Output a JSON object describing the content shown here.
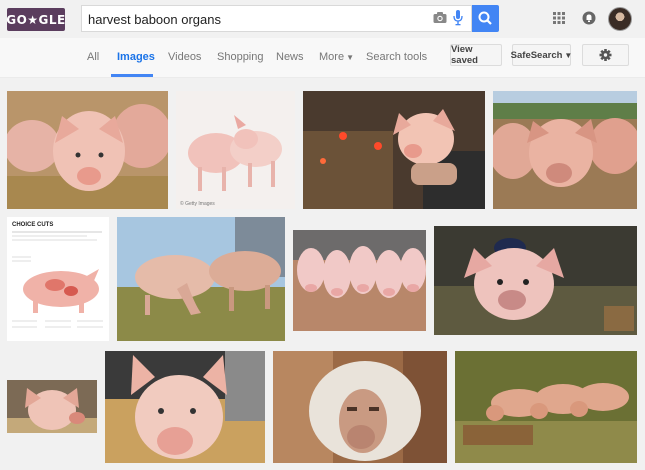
{
  "header": {
    "logo_text": "GO★GLE",
    "search_value": "harvest baboon organs"
  },
  "nav": {
    "tabs": [
      "All",
      "Images",
      "Videos",
      "Shopping",
      "News",
      "More",
      "Search tools"
    ],
    "active_tab": "Images",
    "view_saved": "View saved",
    "safesearch": "SafeSearch"
  },
  "results": {
    "infographic_title": "CHOICE CUTS",
    "image_credit": "© Getty Images"
  },
  "colors": {
    "accent": "#4285f4",
    "logo_bg": "#5b3d5e"
  }
}
